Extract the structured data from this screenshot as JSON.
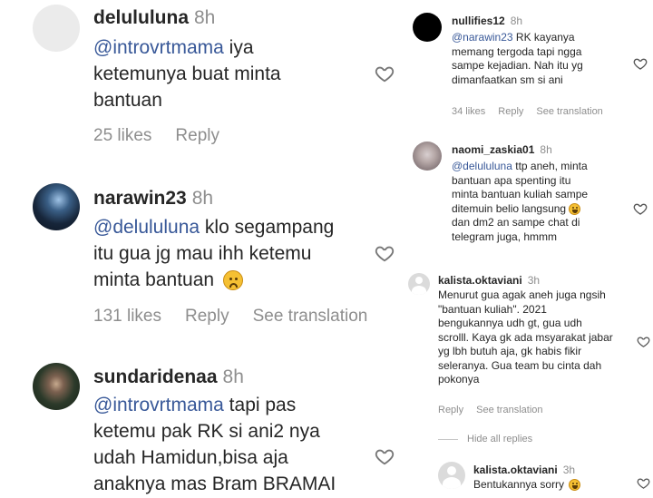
{
  "left": {
    "comments": [
      {
        "username": "delululuna",
        "time": "8h",
        "mention": "@introvrtmama",
        "text_line1": " iya",
        "text_line2": "ketemunya buat minta",
        "text_line3": "bantuan",
        "likes": "25 likes",
        "reply": "Reply"
      },
      {
        "username": "narawin23",
        "time": "8h",
        "mention": "@delululuna",
        "text_line1": " klo segampang",
        "text_line2": "itu gua jg mau ihh ketemu",
        "text_line3": "minta bantuan",
        "likes": "131 likes",
        "reply": "Reply",
        "see_translation": "See translation"
      },
      {
        "username": "sundaridenaa",
        "time": "8h",
        "mention": "@introvrtmama",
        "text_line1": " tapi pas",
        "text_line2": "ketemu pak RK si ani2 nya",
        "text_line3": "udah Hamidun,bisa aja",
        "text_line4": "anaknya mas Bram BRAMAI"
      }
    ]
  },
  "right": {
    "comments": [
      {
        "username": "nullifies12",
        "time": "8h",
        "mention": "@narawin23",
        "text_line1": " RK kayanya",
        "text_line2": "memang tergoda tapi ngga",
        "text_line3": "sampe kejadian. Nah itu yg",
        "text_line4": "dimanfaatkan sm si ani",
        "likes": "34 likes",
        "reply": "Reply",
        "see_translation": "See translation"
      },
      {
        "username": "naomi_zaskia01",
        "time": "8h",
        "mention": "@delululuna",
        "text_line1": " ttp aneh, minta",
        "text_line2": "bantuan apa spenting itu",
        "text_line3": "minta bantuan kuliah sampe",
        "text_line4": "ditemuin belio langsung",
        "text_line5": "dan dm2 an sampe chat di",
        "text_line6": "telegram juga, hmmm"
      },
      {
        "username": "kalista.oktaviani",
        "time": "3h",
        "text_line1": "Menurut gua agak aneh juga ngsih",
        "text_line2": "\"bantuan kuliah\". 2021",
        "text_line3": "bengukannya udh gt, gua udh",
        "text_line4": "scrolll. Kaya gk ada msyarakat jabar",
        "text_line5": "yg lbh butuh aja, gk habis fikir",
        "text_line6": "seleranya. Gua team bu cinta dah",
        "text_line7": "pokonya",
        "reply": "Reply",
        "see_translation": "See translation",
        "hide_replies": "Hide all replies"
      },
      {
        "username": "kalista.oktaviani",
        "time": "3h",
        "text_line1": "Bentukannya sorry"
      }
    ]
  },
  "colors": {
    "text": "#262626",
    "muted": "#8e8e8e",
    "mention": "#385898"
  }
}
